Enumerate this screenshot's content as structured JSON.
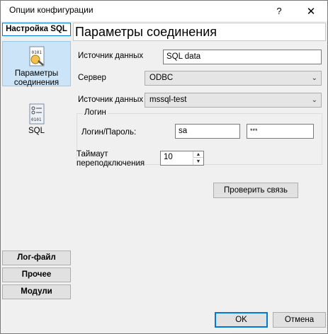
{
  "window": {
    "title": "Опции конфигурации",
    "help_glyph": "?",
    "close_glyph": "✕"
  },
  "sidebar": {
    "header": "Настройка SQL",
    "items": [
      {
        "label": "Параметры соединения",
        "icon": "connection-settings-icon",
        "selected": true
      },
      {
        "label": "SQL",
        "icon": "sql-icon",
        "selected": false
      }
    ],
    "buttons": [
      "Лог-файл",
      "Прочее",
      "Модули"
    ]
  },
  "main": {
    "title": "Параметры соединения",
    "datasource_label": "Источник данных",
    "datasource_value": "SQL data",
    "server_label": "Сервер",
    "server_value": "ODBC",
    "odbc_source_label": "Источник данных",
    "odbc_source_value": "mssql-test",
    "login_group": {
      "title": "Логин",
      "label": "Логин/Пароль:",
      "login_value": "sa",
      "password_value": "***"
    },
    "timeout_label_1": "Таймаут",
    "timeout_label_2": "переподключения",
    "timeout_value": "10",
    "check_button": "Проверить связь"
  },
  "footer": {
    "ok": "OK",
    "cancel": "Отмена"
  },
  "colors": {
    "accent": "#0078d7",
    "selected_bg": "#cce4f7"
  }
}
